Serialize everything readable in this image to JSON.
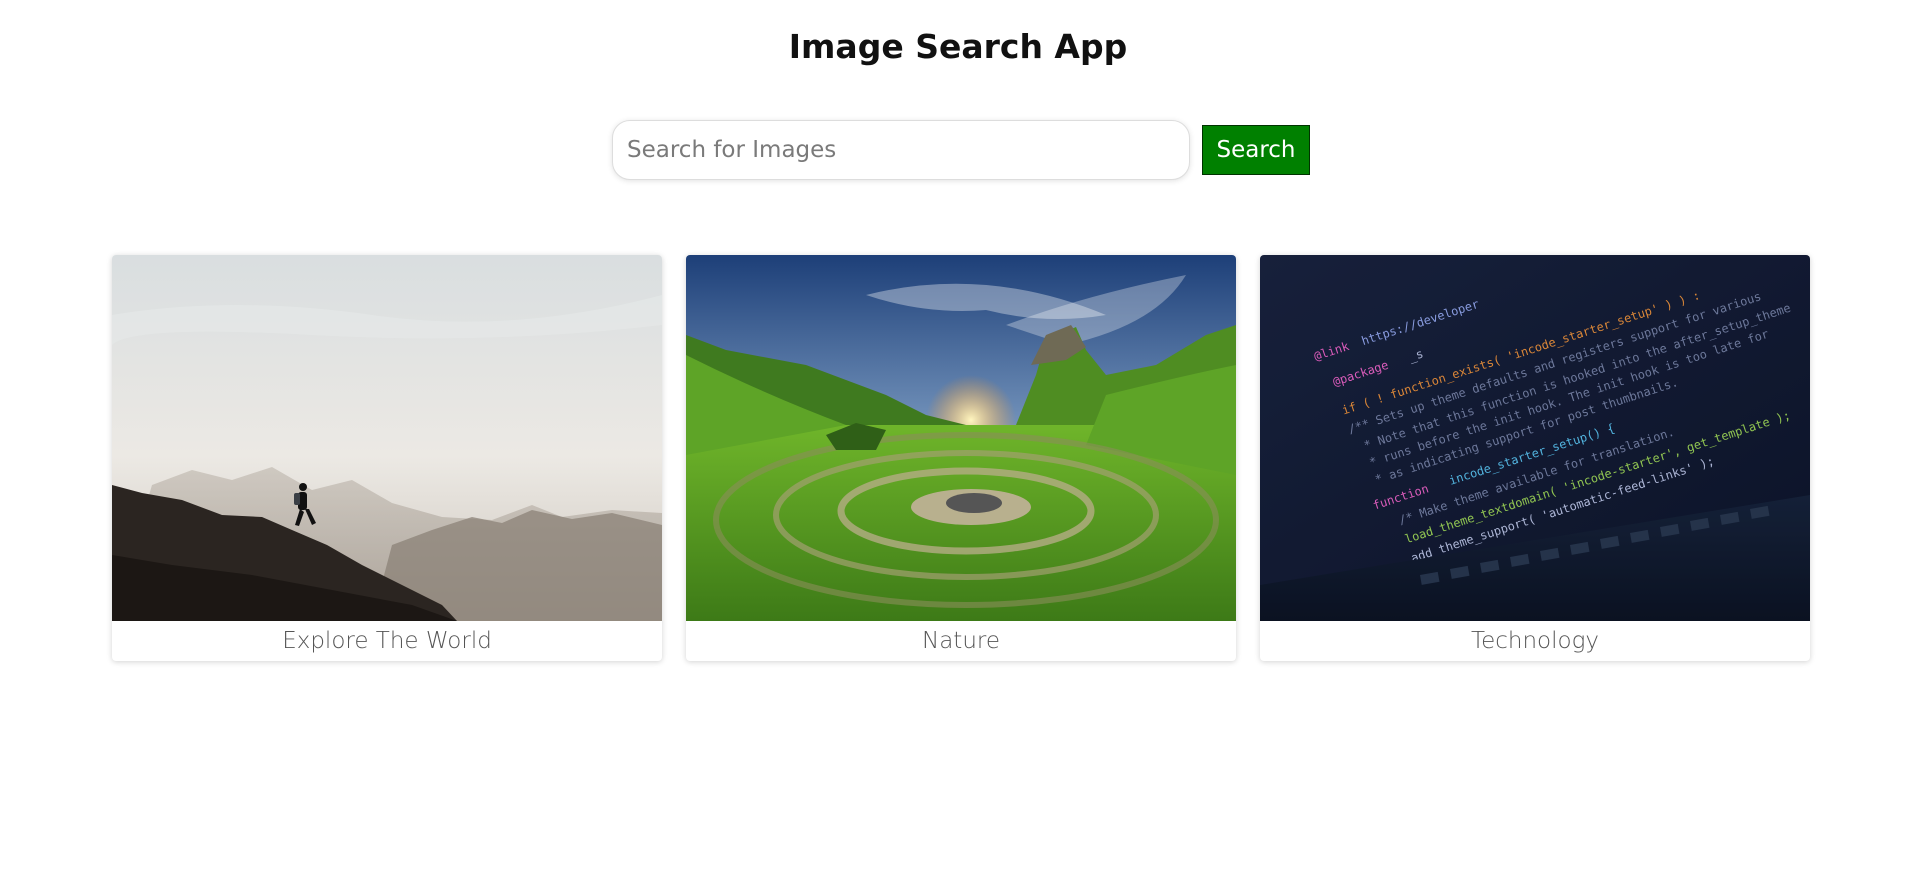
{
  "header": {
    "title": "Image Search App"
  },
  "search": {
    "placeholder": "Search for Images",
    "value": "",
    "button_label": "Search",
    "button_color": "#008000"
  },
  "gallery": {
    "cards": [
      {
        "caption": "Explore The World",
        "image": "hiker-on-mountain-ridge-image"
      },
      {
        "caption": "Nature",
        "image": "green-valley-stone-spiral-image"
      },
      {
        "caption": "Technology",
        "image": "laptop-code-editor-image"
      }
    ]
  }
}
